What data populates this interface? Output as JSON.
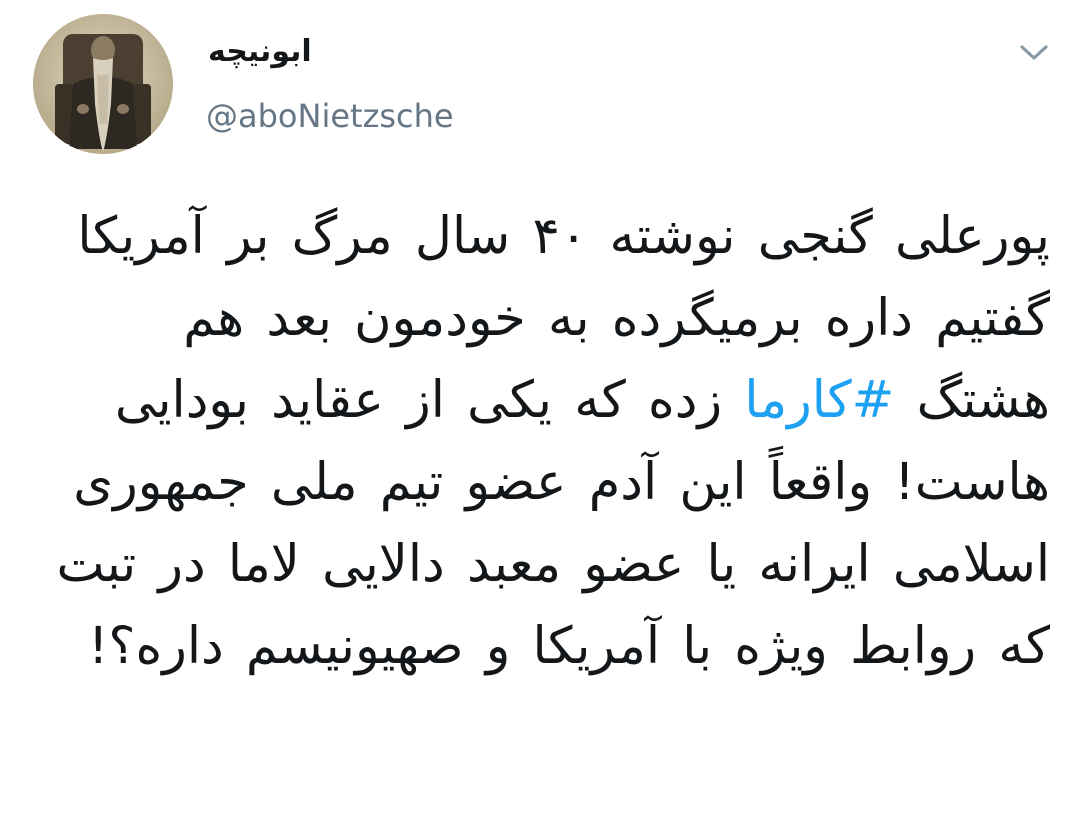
{
  "user": {
    "display_name": "ابونیچه",
    "handle": "@aboNietzsche",
    "avatar": "avatar-photo"
  },
  "menu": {
    "caret_icon": "chevron-down-icon"
  },
  "tweet": {
    "text_before_hashtag": "پورعلی گنجی نوشته ۴۰ سال مرگ بر آمریکا گفتیم داره برمیگرده به خودمون بعد هم هشتگ ",
    "hashtag": "#کارما",
    "text_after_hashtag": " زده که یکی از عقاید بودایی هاست! واقعاً این آدم عضو تیم ملی جمهوری اسلامی ایرانه یا عضو معبد دالایی لاما در تبت که روابط ویژه با آمریکا و صهیونیسم داره؟!"
  },
  "colors": {
    "text": "#14171a",
    "secondary": "#657786",
    "link": "#1da1f2"
  }
}
